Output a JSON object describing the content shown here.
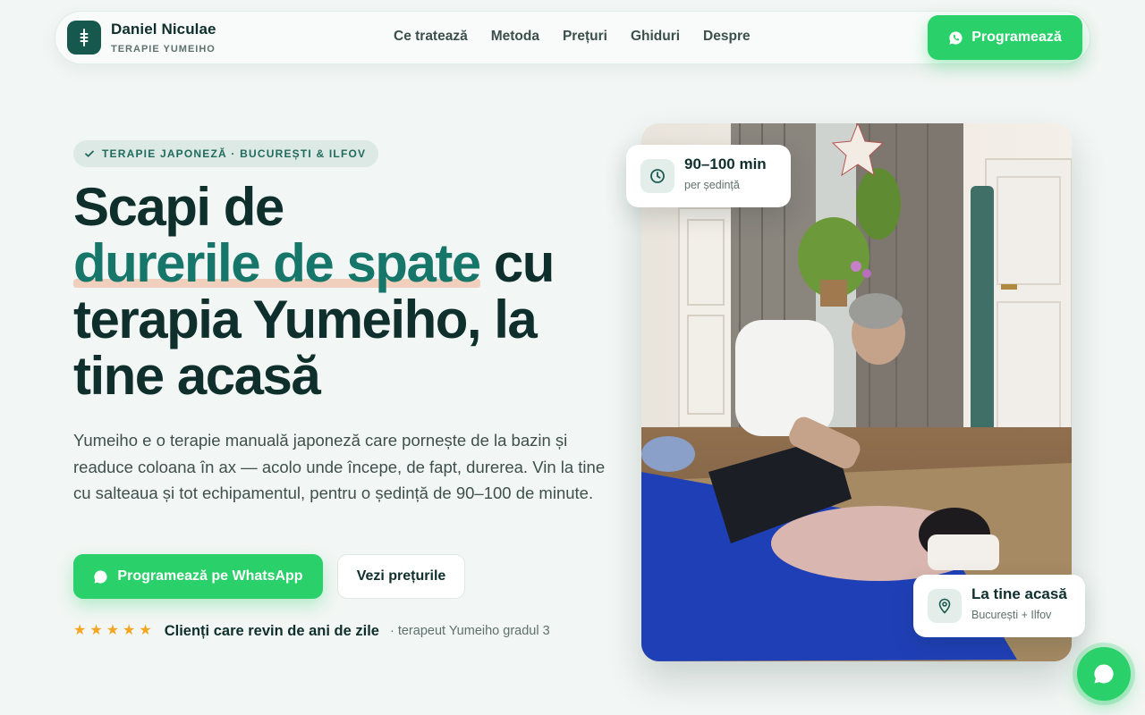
{
  "header": {
    "brand_name": "Daniel Niculae",
    "brand_sub": "TERAPIE YUMEIHO",
    "nav": [
      "Ce tratează",
      "Metoda",
      "Prețuri",
      "Ghiduri",
      "Despre"
    ],
    "cta_label": "Programează"
  },
  "hero": {
    "badge": "TERAPIE JAPONEZĂ · BUCUREȘTI & ILFOV",
    "title_1": "Scapi de",
    "title_highlight": "durerile de spate",
    "title_2": " cu terapia Yumeiho, la tine acasă",
    "description": "Yumeiho e o terapie manuală japoneză care pornește de la bazin și readuce coloana în ax — acolo unde începe, de fapt, durerea. Vin la tine cu salteaua și tot echipamentul, pentru o ședință de 90–100 de minute.",
    "primary_button": "Programează pe WhatsApp",
    "secondary_button": "Vezi prețurile",
    "rating_stars": 5,
    "rating_text": "Clienți care revin de ani de zile",
    "rating_sub": "· terapeut Yumeiho gradul 3"
  },
  "cards": {
    "duration_title": "90–100 min",
    "duration_sub": "per ședință",
    "location_title": "La tine acasă",
    "location_sub": "București + Ilfov"
  },
  "colors": {
    "accent_green": "#2ad06a",
    "brand_dark": "#16574e",
    "highlight_teal": "#17766a",
    "highlight_underline": "#f1cfbd",
    "star": "#f4a521"
  },
  "icons": {
    "logo": "spine-icon",
    "whatsapp": "whatsapp-icon",
    "check": "check-icon",
    "clock": "clock-icon",
    "location": "location-pin-icon",
    "chat": "chat-bubble-icon"
  }
}
